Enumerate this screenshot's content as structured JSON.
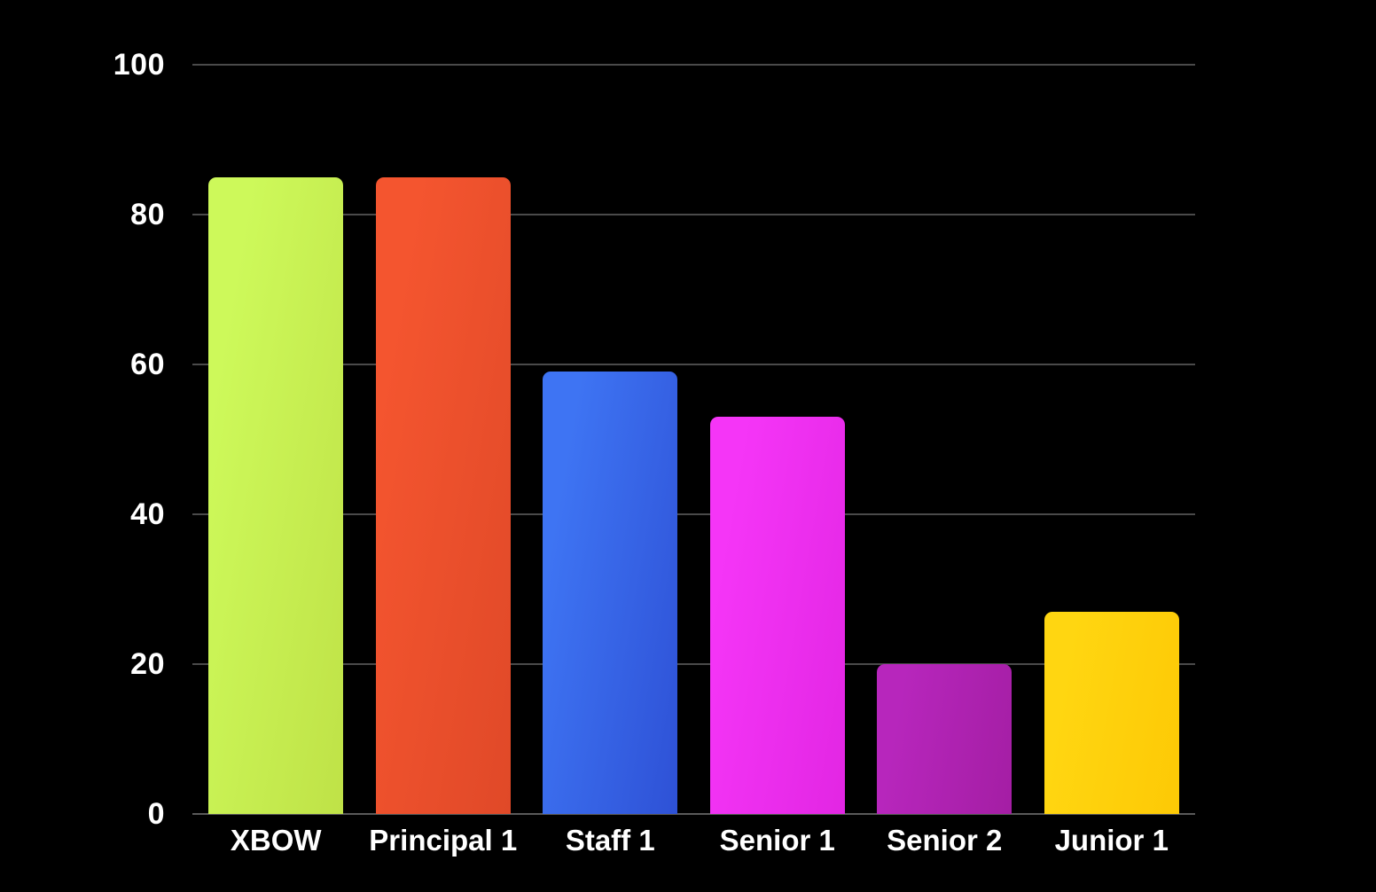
{
  "background_color": "#000000",
  "axis": {
    "y_ticks": [
      "0",
      "20",
      "40",
      "60",
      "80",
      "100"
    ],
    "x_labels": [
      "XBOW",
      "Principal 1",
      "Staff 1",
      "Senior 1",
      "Senior 2",
      "Junior 1"
    ],
    "tick_color": "#ffffff",
    "gridline_color": "#4a4a4a"
  },
  "chart_data": {
    "type": "bar",
    "title": "",
    "subtitle": "",
    "xlabel": "",
    "ylabel": "",
    "categories": [
      "XBOW",
      "Principal 1",
      "Staff 1",
      "Senior 1",
      "Senior 2",
      "Junior 1"
    ],
    "values": [
      85,
      85,
      59,
      53,
      20,
      27
    ],
    "colors": [
      "#c8f04e",
      "#ef4f2d",
      "#3566ea",
      "#ec2ded",
      "#ad22b2",
      "#ffd10a"
    ],
    "bar_gradients": [
      {
        "from": "#cdf95a",
        "to": "#bfe247"
      },
      {
        "from": "#f4552f",
        "to": "#e04928"
      },
      {
        "from": "#3e74f3",
        "to": "#2e51d6"
      },
      {
        "from": "#f535f7",
        "to": "#e226e3"
      },
      {
        "from": "#b726bc",
        "to": "#a41ea4"
      },
      {
        "from": "#ffd611",
        "to": "#fdc905"
      }
    ],
    "ylim": [
      0,
      100
    ],
    "y_ticks": [
      0,
      20,
      40,
      60,
      80,
      100
    ],
    "grid": true,
    "grid_axis": "y",
    "legend": "none",
    "bar_corner_radius": 9
  }
}
